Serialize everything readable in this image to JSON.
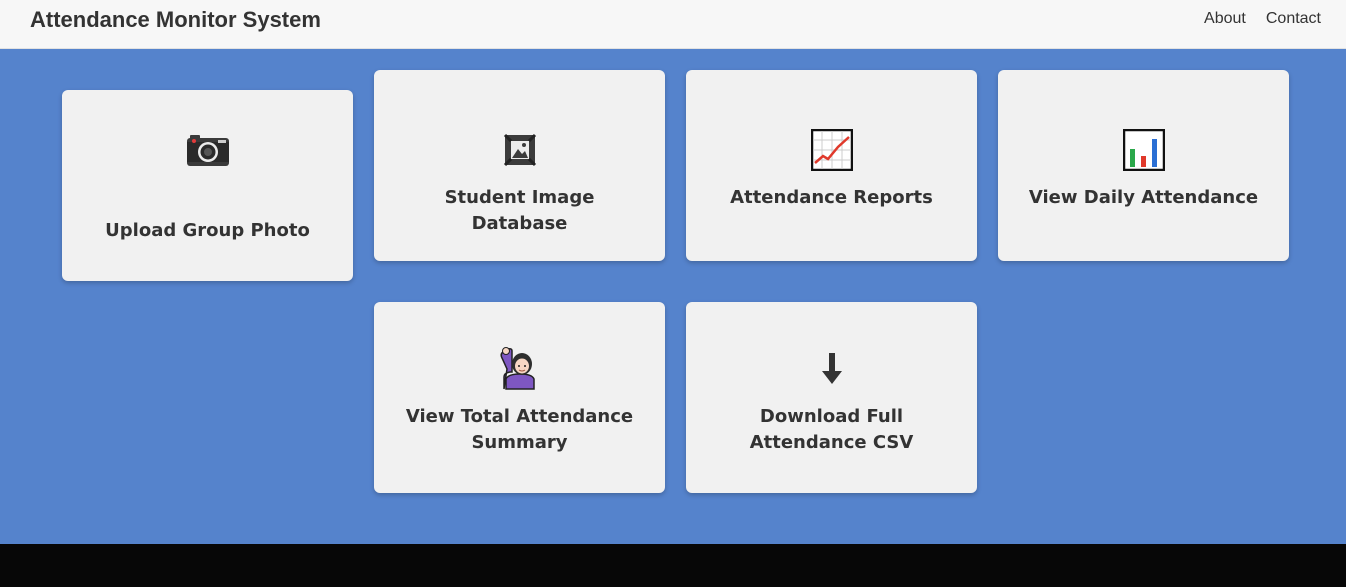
{
  "header": {
    "title": "Attendance Monitor System",
    "links": [
      "About",
      "Contact"
    ]
  },
  "cards": [
    {
      "label": "Upload Group Photo",
      "icon": "camera-icon"
    },
    {
      "label": "Student Image Database",
      "icon": "picture-frame-icon"
    },
    {
      "label": "Attendance Reports",
      "icon": "chart-increasing-icon"
    },
    {
      "label": "View Daily Attendance",
      "icon": "bar-chart-icon"
    },
    {
      "label": "View Total Attendance Summary",
      "icon": "person-raising-hand-icon"
    },
    {
      "label": "Download Full Attendance CSV",
      "icon": "down-arrow-icon"
    }
  ],
  "colors": {
    "background": "#5583cc",
    "navbar": "#f7f7f7",
    "card": "#f1f1f1",
    "footer": "#070707",
    "text": "#333333"
  }
}
